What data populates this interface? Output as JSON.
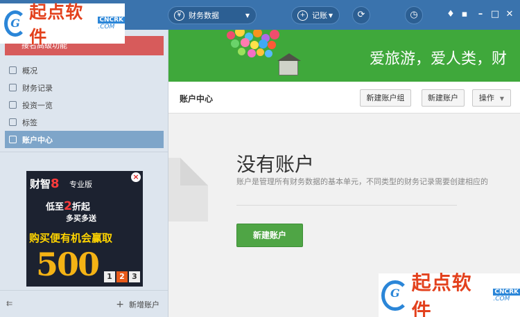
{
  "toolbar": {
    "finance_label": "财务数据",
    "book_label": "记账",
    "icons": [
      "chart-icon",
      "plus-icon",
      "sync-icon",
      "clock-icon",
      "skin-icon",
      "message-icon",
      "minimize-icon",
      "maximize-icon",
      "close-icon"
    ]
  },
  "watermark": {
    "text": "起点软件",
    "tag_top": "CNCRK",
    "tag_bottom": ".COM"
  },
  "sidebar": {
    "promo_label": "接名高级功能",
    "items": [
      {
        "label": "概况",
        "active": false
      },
      {
        "label": "财务记录",
        "active": false
      },
      {
        "label": "投资一览",
        "active": false
      },
      {
        "label": "标签",
        "active": false
      },
      {
        "label": "账户中心",
        "active": true
      }
    ],
    "add_account_label": "新增账户",
    "collapse_icon": "collapse-left-icon"
  },
  "ad": {
    "brand": "财智",
    "brand_num": "8",
    "edition": "专业版",
    "line1_prefix": "低至",
    "line1_num": "2",
    "line1_suffix": "折起",
    "line2": "多买多送",
    "line3": "购买便有机会赢取",
    "big_number": "500",
    "digits": [
      "1",
      "2",
      "3"
    ]
  },
  "banner": {
    "slogan": "爱旅游，爱人类，财"
  },
  "header": {
    "title": "账户中心",
    "new_group_label": "新建账户组",
    "new_account_label": "新建账户",
    "operations_label": "操作"
  },
  "empty_state": {
    "title": "没有账户",
    "description": "账户是管理所有财务数据的基本单元，不同类型的财务记录需要创建相应的",
    "button_label": "新建账户"
  },
  "colors": {
    "topbar": "#3a73ad",
    "sidebar": "#dde5ee",
    "active_item": "#7ea5c9",
    "banner": "#3fa83b",
    "primary_button": "#4fa545",
    "promo": "#d75b5b"
  }
}
